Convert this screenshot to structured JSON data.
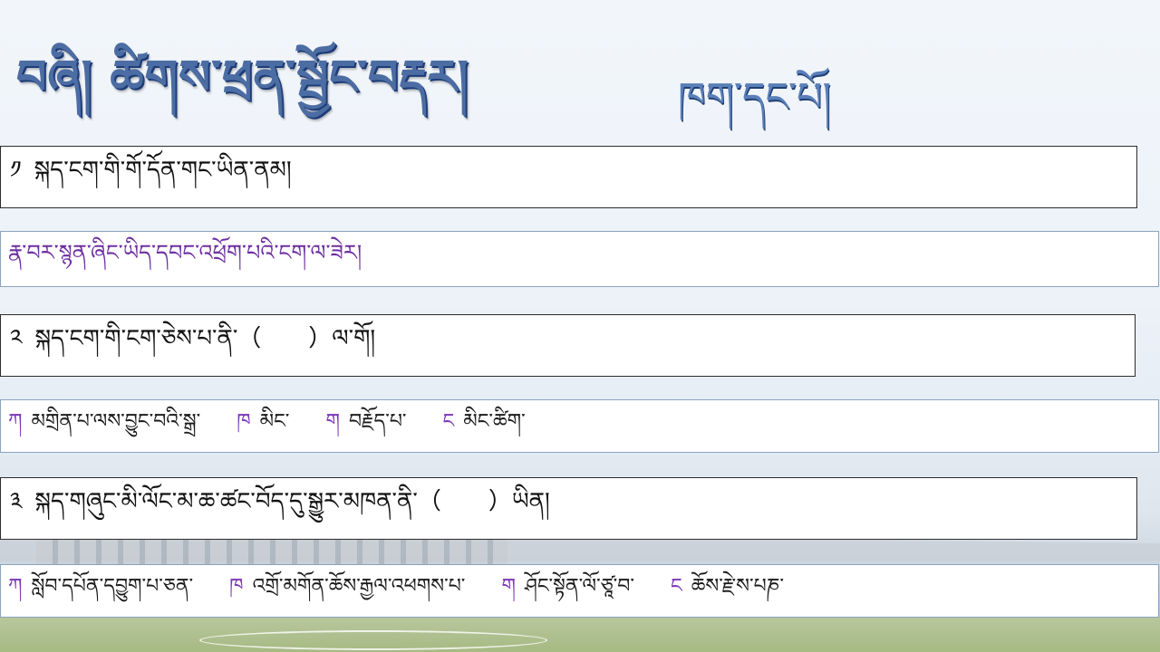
{
  "title": {
    "main": "བཞི།   ཚིགས་ཕྲན་སྦྱོང་བརྡར།",
    "sub": "ཁག་དང་པོ།"
  },
  "q1": {
    "num": "༡",
    "text": "སྐད་ངག་གི་གོ་དོན་གང་ཡིན་ནམ།"
  },
  "note": {
    "text": "རྣ་བར་སྙན་ཞིང་ཡིད་དབང་འཕྲོག་པའི་ངག་ལ་ཟེར།"
  },
  "q2": {
    "num": "༢",
    "text": "སྐད་ངག་གི་ངག་ཅེས་པ་ནི་（　　）ལ་གོ།"
  },
  "q2_options": [
    {
      "letter": "ཀ",
      "text": "མགྲིན་པ་ལས་བྱུང་བའི་སྒྲ་"
    },
    {
      "letter": "ཁ",
      "text": "མིང་"
    },
    {
      "letter": "ག",
      "text": "བརྗོད་པ་"
    },
    {
      "letter": "ང",
      "text": "མིང་ཚིག་"
    }
  ],
  "q3": {
    "num": "༣",
    "text": "སྐད་གཞུང་མི་ལོང་མ་ཆ་ཚང་བོད་དུ་སྒྱུར་མཁན་ནི་（　　）ཡིན།"
  },
  "q3_options": [
    {
      "letter": "ཀ",
      "text": "སློབ་དཔོན་དབྱུག་པ་ཅན་"
    },
    {
      "letter": "ཁ",
      "text": "འགྲོ་མགོན་ཆོས་རྒྱལ་འཕགས་པ་"
    },
    {
      "letter": "ག",
      "text": "ཤོང་སྟོན་ལོ་ཙཱ་བ་"
    },
    {
      "letter": "ང",
      "text": "ཆོས་རྗེ་ས་པཎ་"
    }
  ]
}
